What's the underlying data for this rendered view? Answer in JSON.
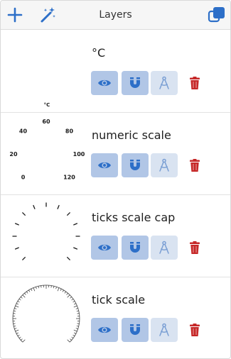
{
  "toolbar": {
    "title": "Layers",
    "add_icon": "plus-icon",
    "magic_icon": "magic-wand-icon",
    "duplicate_icon": "copy-icon",
    "accent_color": "#2d6fc8"
  },
  "layers": [
    {
      "name": "°C",
      "unit_label": "°C"
    },
    {
      "name": "numeric scale",
      "scale_labels": [
        "0",
        "20",
        "40",
        "60",
        "80",
        "100",
        "120"
      ]
    },
    {
      "name": "ticks scale cap"
    },
    {
      "name": "tick scale"
    }
  ],
  "buttons": {
    "visibility_icon": "eye-icon",
    "snap_icon": "magnet-icon",
    "edit_icon": "compass-icon",
    "delete_icon": "trash-icon",
    "delete_color": "#c62828"
  }
}
